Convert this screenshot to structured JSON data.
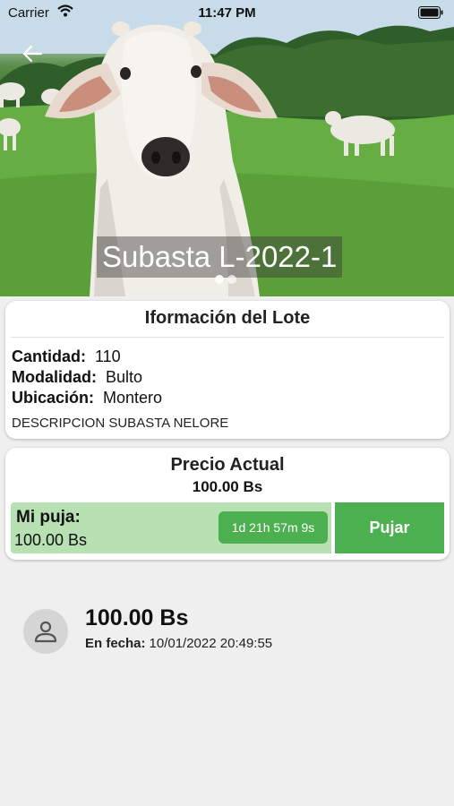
{
  "status_bar": {
    "carrier": "Carrier",
    "time": "11:47 PM"
  },
  "hero": {
    "title": "Subasta L-2022-1",
    "page_count": 2,
    "active_page": 1
  },
  "lot_info": {
    "title": "Iformación del Lote",
    "rows": [
      {
        "label": "Cantidad:",
        "value": "110"
      },
      {
        "label": "Modalidad:",
        "value": "Bulto"
      },
      {
        "label": "Ubicación:",
        "value": "Montero"
      }
    ],
    "description": "DESCRIPCION SUBASTA NELORE"
  },
  "price": {
    "title": "Precio Actual",
    "value": "100.00 Bs",
    "my_bid_label": "Mi puja:",
    "my_bid_value": "100.00 Bs",
    "countdown": "1d 21h 57m 9s",
    "bid_button": "Pujar"
  },
  "history": [
    {
      "amount": "100.00 Bs",
      "date_label": "En fecha:",
      "date": "10/01/2022 20:49:55"
    }
  ],
  "colors": {
    "accent": "#4caf50",
    "my_bid_bg": "#b7e0b3",
    "background": "#efefef"
  },
  "icons": {
    "back": "arrow-left-icon",
    "wifi": "wifi-icon",
    "battery": "battery-icon",
    "avatar": "person-icon"
  }
}
